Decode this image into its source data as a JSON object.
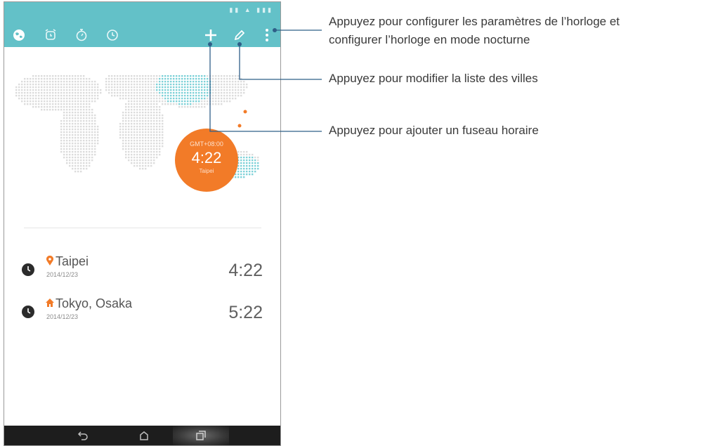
{
  "toolbar": {
    "icons": [
      "world-clock-icon",
      "alarm-icon",
      "stopwatch-icon",
      "timer-icon",
      "add-icon",
      "edit-icon",
      "overflow-menu-icon"
    ],
    "accent_color": "#63c1c8"
  },
  "map": {
    "marker": {
      "gmt": "GMT+08:00",
      "time": "4:22",
      "city": "Taipei"
    },
    "marker_color": "#f27b28"
  },
  "cities": [
    {
      "name": "Taipei",
      "date": "2014/12/23",
      "time": "4:22",
      "icon": "location-pin-icon"
    },
    {
      "name": "Tokyo, Osaka",
      "date": "2014/12/23",
      "time": "5:22",
      "icon": "home-icon"
    }
  ],
  "navbar": {
    "icons": [
      "back-icon",
      "home-icon",
      "recent-apps-icon"
    ]
  },
  "callouts": {
    "settings_line1": "Appuyez pour configurer les paramètres de l’horloge et",
    "settings_line2": "configurer l’horloge en mode nocturne",
    "edit": "Appuyez pour modifier la liste des villes",
    "add": "Appuyez pour ajouter un fuseau horaire"
  }
}
